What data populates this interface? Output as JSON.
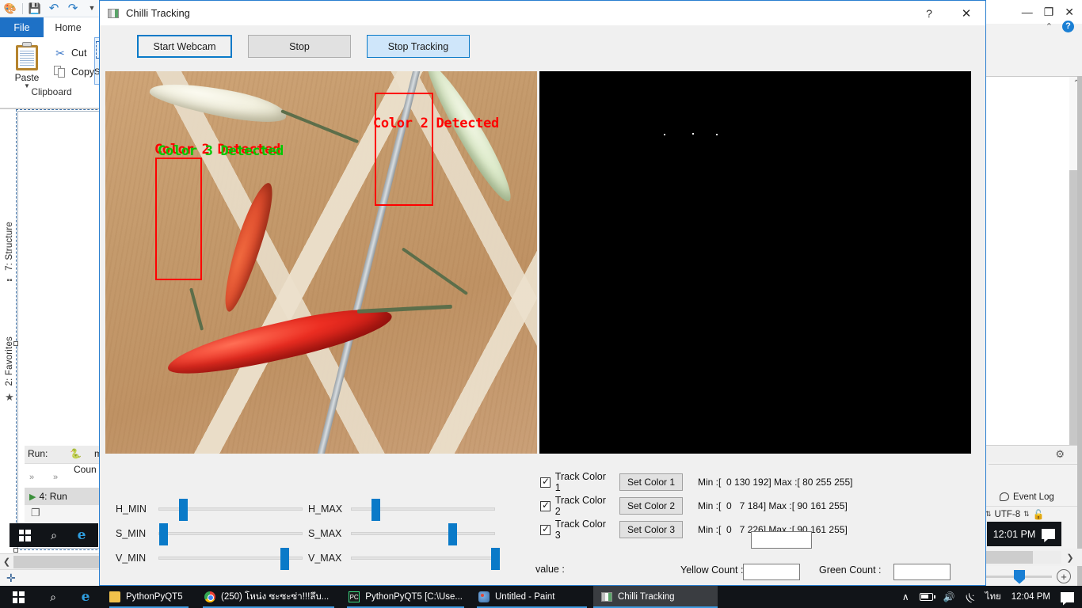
{
  "paint_window": {
    "quick_access": [
      "paint-icon",
      "save-icon",
      "undo-icon",
      "redo-icon",
      "customize-caret-icon"
    ],
    "tabs": [
      {
        "label": "File"
      },
      {
        "label": "Home"
      }
    ],
    "clipboard": {
      "paste_label": "Paste",
      "cut_label": "Cut",
      "copy_label": "Copy",
      "group_label": "Clipboard"
    },
    "select_tool_letter": "S"
  },
  "pycharm": {
    "vertical_tabs": [
      {
        "label": "7: Structure",
        "icon": "structure-icon"
      },
      {
        "label": "2: Favorites",
        "icon": "star-icon"
      }
    ],
    "run_label": "Run:",
    "run_config": "main",
    "run_output": "Coun",
    "run_tool_tab": "4: Run",
    "step_arrows": [
      "»",
      "»"
    ],
    "event_log": "Event Log",
    "encoding": "UTF-8",
    "clock_overlay": "12:01 PM"
  },
  "app": {
    "title": "Chilli Tracking",
    "title_buttons": [
      {
        "name": "help-button",
        "glyph": "?"
      },
      {
        "name": "close-button",
        "glyph": "✕"
      }
    ],
    "toolbar": {
      "start_webcam": "Start Webcam",
      "stop": "Stop",
      "stop_tracking": "Stop Tracking"
    },
    "video_left": {
      "detections": [
        {
          "label": "Color 2 Detected",
          "color": "#ff0000"
        },
        {
          "label": "Color 3 Detected",
          "color": "#00c800"
        },
        {
          "label": "Color 2 Detected",
          "color": "#ff0000"
        }
      ]
    },
    "sliders": [
      {
        "label": "H_MIN",
        "pos_pct": 14
      },
      {
        "label": "H_MAX",
        "pos_pct": 14
      },
      {
        "label": "S_MIN",
        "pos_pct": 1
      },
      {
        "label": "S_MAX",
        "pos_pct": 68
      },
      {
        "label": "V_MIN",
        "pos_pct": 85
      },
      {
        "label": "V_MAX",
        "pos_pct": 98
      }
    ],
    "track_rows": [
      {
        "checkbox_label": "Track Color 1",
        "checked": true,
        "button_label": "Set Color 1",
        "range_text": "Min :[  0 130 192] Max :[ 80 255 255]"
      },
      {
        "checkbox_label": "Track Color 2",
        "checked": true,
        "button_label": "Set Color 2",
        "range_text": "Min :[  0   7 184] Max :[ 90 161 255]"
      },
      {
        "checkbox_label": "Track Color 3",
        "checked": true,
        "button_label": "Set Color 3",
        "range_text": "Min :[  0   7 226] Max :[ 90 161 255]"
      }
    ],
    "extra_field_value": "",
    "footer": {
      "value_label": "value :",
      "yellow_count_label": "Yellow  Count :",
      "yellow_count_value": "",
      "green_count_label": "Green  Count :",
      "green_count_value": ""
    }
  },
  "taskbar": {
    "start_icon": "windows-start-icon",
    "search_icon": "search-icon",
    "edge_icon": "edge-browser-icon",
    "items": [
      {
        "label": "PythonPyQT5",
        "icon": "folder-icon",
        "active": false
      },
      {
        "label": "(250) โหน่ง ซะซะซ่า!!!ลึบ...",
        "icon": "chrome-icon",
        "active": false
      },
      {
        "label": "PythonPyQT5 [C:\\Use...",
        "icon": "pycharm-icon",
        "active": false
      },
      {
        "label": "Untitled - Paint",
        "icon": "paint-icon",
        "active": false
      },
      {
        "label": "Chilli Tracking",
        "icon": "chilli-app-icon",
        "active": true
      }
    ],
    "tray": {
      "chevron": "∧",
      "battery_icon": "battery-icon",
      "volume_icon": "volume-icon",
      "network_icon": "wifi-icon",
      "language": "ไทย",
      "clock": "12:04 PM",
      "action_center_icon": "action-center-icon"
    }
  },
  "colors": {
    "accent": "#0a7ac8",
    "taskbar_bg": "#111418",
    "window_bg": "#f0f0f0",
    "detect_red": "#ff0000",
    "detect_green": "#00c800"
  }
}
